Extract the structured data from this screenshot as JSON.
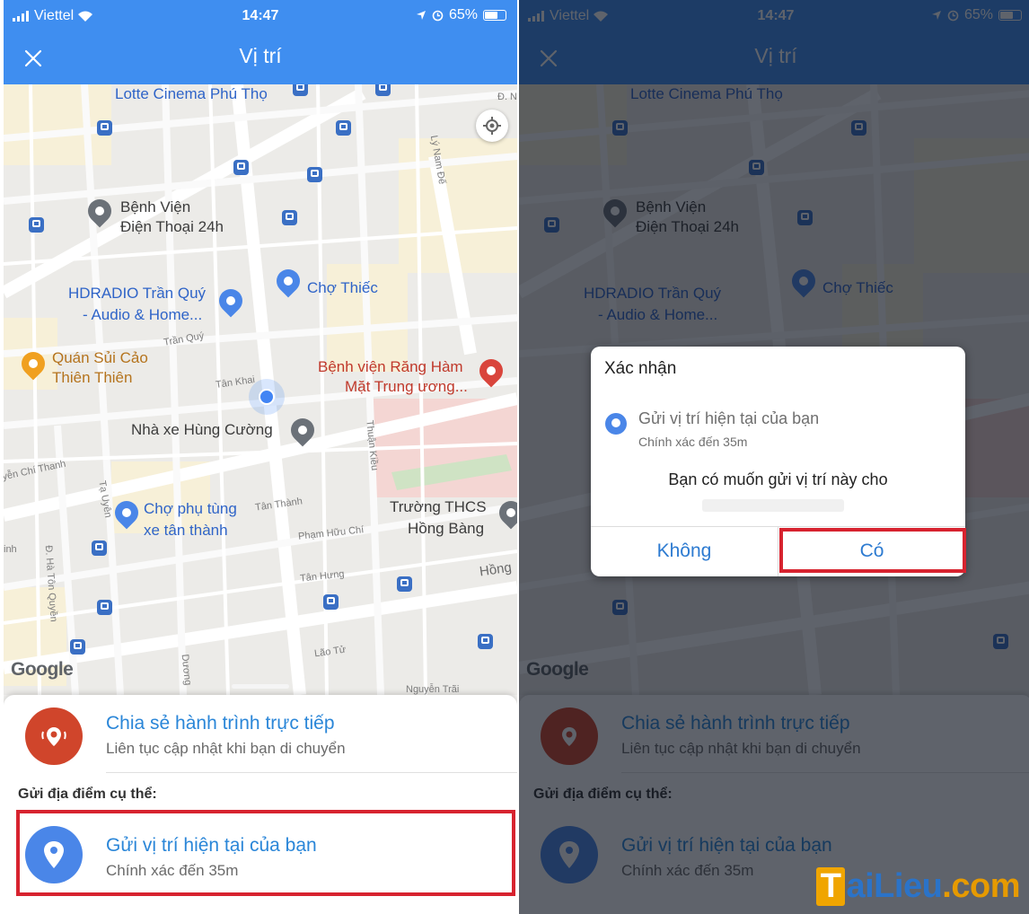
{
  "status": {
    "carrier": "Viettel",
    "time": "14:47",
    "battery": "65%"
  },
  "nav": {
    "title": "Vị trí"
  },
  "map": {
    "places": {
      "lotte": "Lotte Cinema Phú Thọ",
      "hospital1_l1": "Bệnh Viện",
      "hospital1_l2": "Điện Thoại 24h",
      "hdradio_l1": "HDRADIO Trần Quý",
      "hdradio_l2": "- Audio & Home...",
      "cho_thiec": "Chợ Thiếc",
      "quan_l1": "Quán Sủi Cảo",
      "quan_l2": "Thiên Thiên",
      "hospital2_l1": "Bệnh viện Răng Hàm",
      "hospital2_l2": "Mặt Trung ương...",
      "nha_xe": "Nhà xe Hùng Cường",
      "cho_phu_tung_l1": "Chợ phụ tùng",
      "cho_phu_tung_l2": "xe tân thành",
      "truong_l1": "Trường THCS",
      "truong_l2": "Hồng Bàng"
    },
    "streets": {
      "ly_nam_de": "Lý Nam Đế",
      "tran_quy": "Trần Quý",
      "tan_khai": "Tân Khai",
      "thuan_kieu": "Thuận Kiều",
      "nguyen_chi_thanh": "yễn Chí Thanh",
      "ta_uyen": "Tạ Uyên",
      "tan_thanh": "Tân Thành",
      "pham_huu_chi": "Phạm Hữu Chí",
      "tan_hung": "Tân Hưng",
      "hong": "Hồng",
      "ha_ton_quyen": "Đ. Hà Tôn Quyền",
      "lao_tu": "Lão Tử",
      "duong": "Dương",
      "nguyen_trai": "Nguyễn Trãi",
      "dn": "Đ. N",
      "inh": "inh"
    },
    "logo": "Google"
  },
  "sheet": {
    "live_title": "Chia sẻ hành trình trực tiếp",
    "live_sub": "Liên tục cập nhật khi bạn di chuyển",
    "section": "Gửi địa điểm cụ thể:",
    "current_title": "Gửi vị trí hiện tại của bạn",
    "current_sub": "Chính xác đến 35m"
  },
  "dialog": {
    "title": "Xác nhận",
    "loc_title": "Gửi vị trí hiện tại của bạn",
    "loc_sub": "Chính xác đến 35m",
    "message": "Bạn có muốn gửi vị trí này cho",
    "no": "Không",
    "yes": "Có"
  },
  "colors": {
    "appbar": "#3f8ef0",
    "link": "#2a86d8",
    "highlight": "#d7232f",
    "live_icon": "#d0452b",
    "current_icon": "#4a86e8"
  },
  "icons": [
    "close-icon",
    "signal-icon",
    "wifi-icon",
    "location-arrow-icon",
    "alarm-icon",
    "battery-icon",
    "my-location-icon",
    "bus-stop-icon",
    "map-pin-icon",
    "live-share-icon",
    "location-pin-icon"
  ],
  "watermark": {
    "t": "T",
    "rest": "aiLieu",
    "dot": ".com"
  }
}
